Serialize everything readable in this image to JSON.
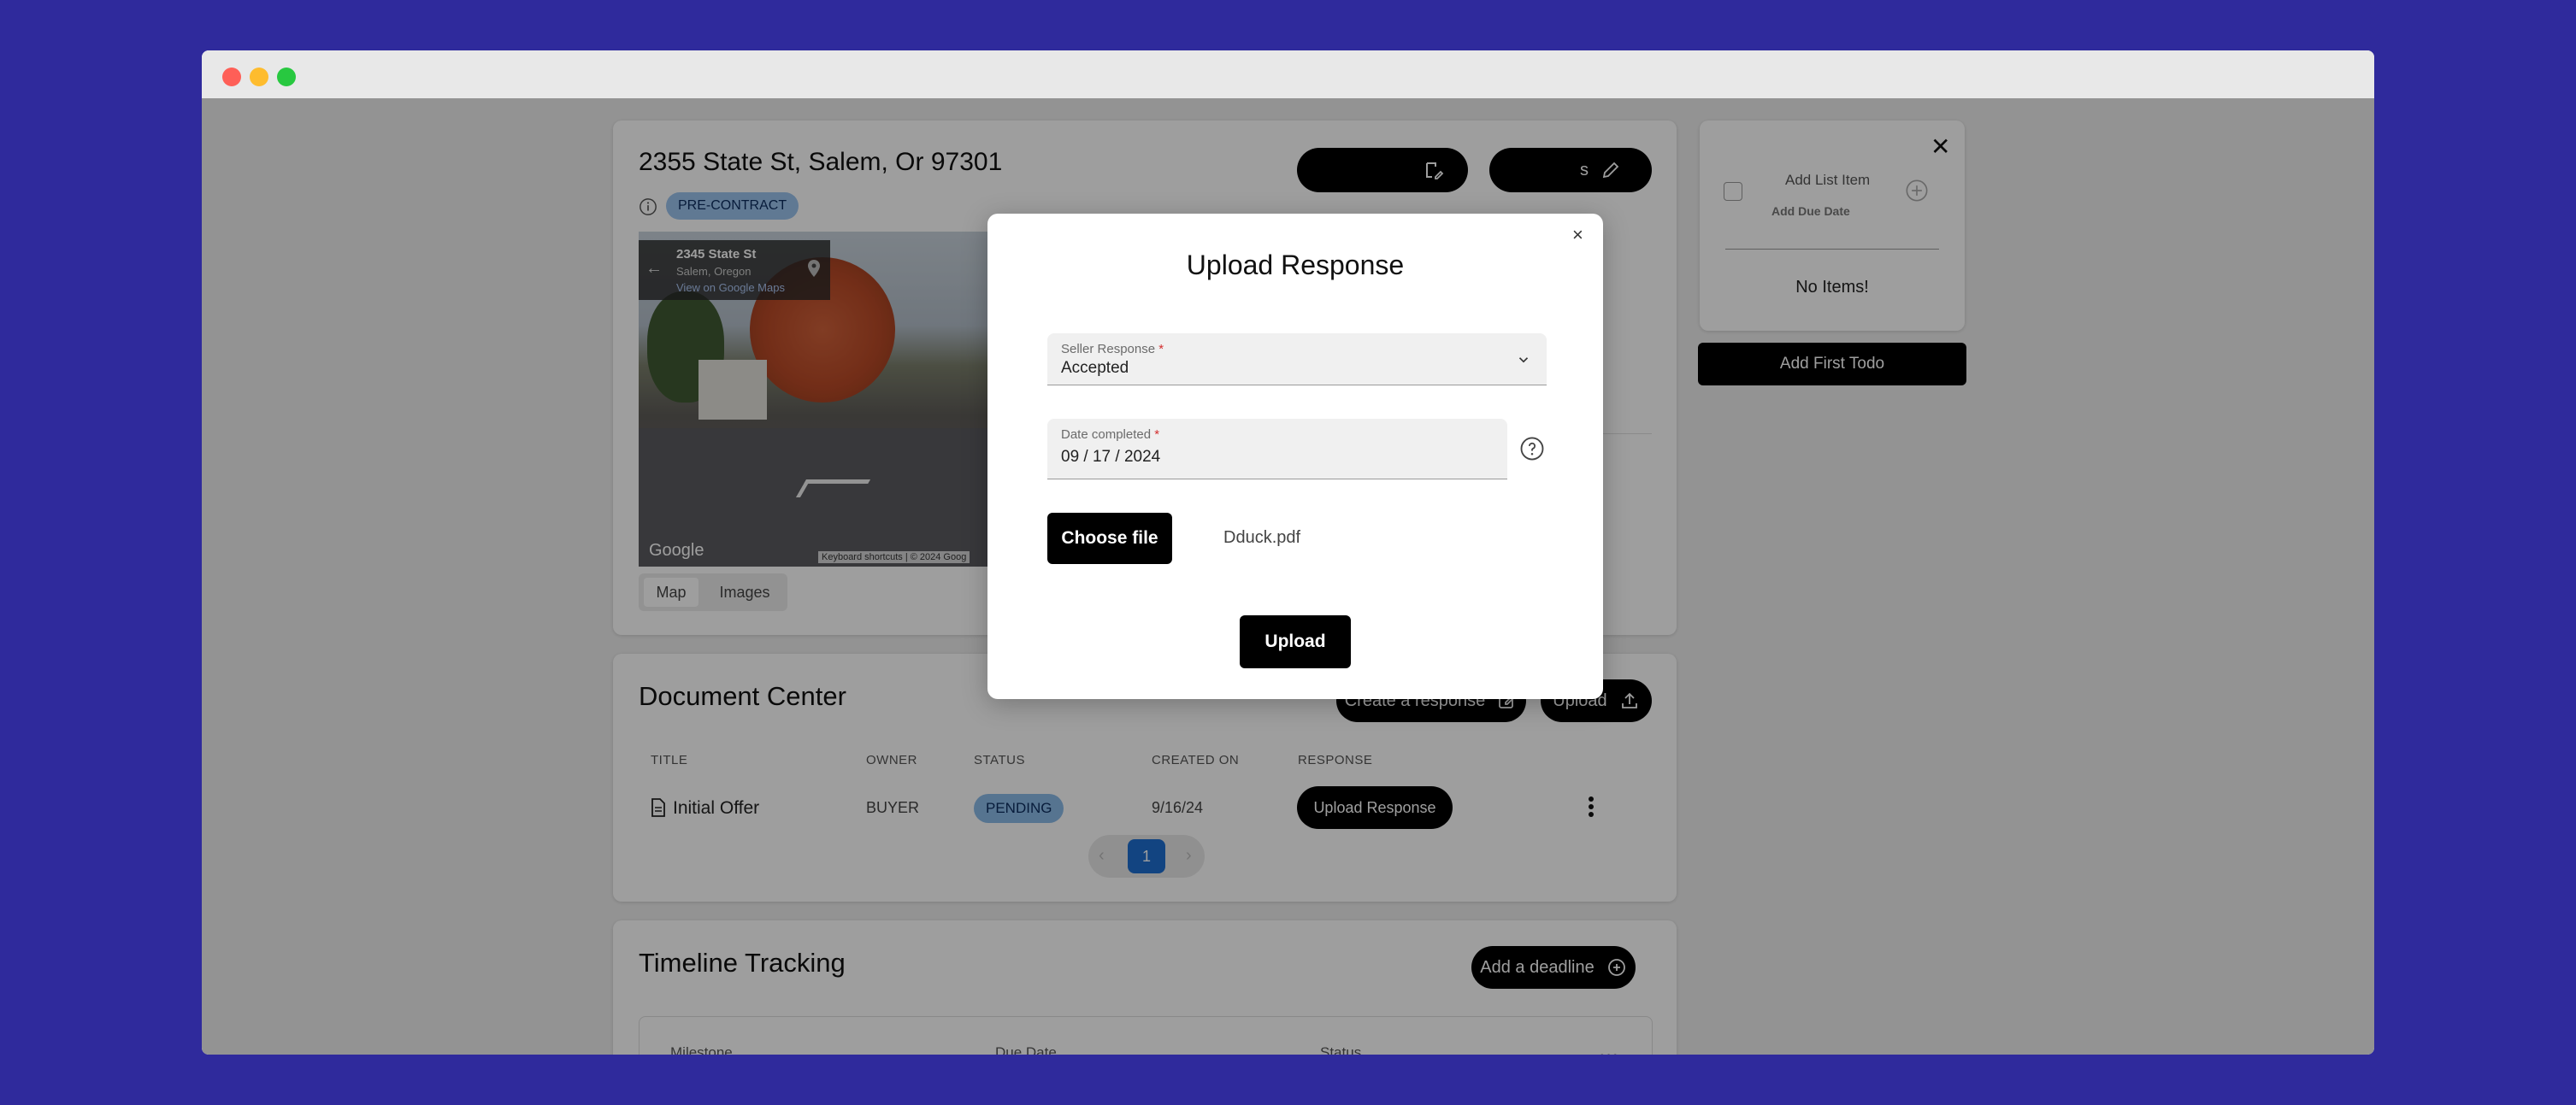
{
  "property": {
    "address": "2355 State St, Salem, Or 97301",
    "stage_badge": "PRE-CONTRACT",
    "map_overlay": {
      "street": "2345 State St",
      "city": "Salem, Oregon",
      "link": "View on Google Maps"
    },
    "map_brand": "Google",
    "map_footer": "Keyboard shortcuts | © 2024 Goog",
    "tabs": [
      "Map",
      "Images"
    ],
    "action_button_2_partial": "s"
  },
  "document_center": {
    "title": "Document Center",
    "create_button": "Create a response",
    "upload_button": "Upload",
    "columns": [
      "TITLE",
      "OWNER",
      "STATUS",
      "CREATED ON",
      "RESPONSE"
    ],
    "rows": [
      {
        "title": "Initial Offer",
        "owner": "BUYER",
        "status": "PENDING",
        "created_on": "9/16/24",
        "response_button": "Upload Response"
      }
    ],
    "pagination": {
      "current_page": "1"
    }
  },
  "timeline": {
    "title": "Timeline Tracking",
    "add_button": "Add a deadline",
    "columns": [
      "Milestone",
      "Due Date",
      "Status"
    ]
  },
  "todo": {
    "add_item_placeholder": "Add List Item",
    "add_due_date": "Add Due Date",
    "empty_text": "No Items!",
    "add_first_button": "Add First Todo"
  },
  "modal": {
    "title": "Upload Response",
    "seller_response_label": "Seller Response",
    "seller_response_value": "Accepted",
    "date_label": "Date completed",
    "date_value": "09 / 17 / 2024",
    "choose_file_button": "Choose file",
    "file_name": "Dduck.pdf",
    "upload_button": "Upload",
    "required_mark": "*"
  },
  "colors": {
    "background": "#2f2a9c",
    "badge_blue": "#9cc3ee",
    "page_active": "#1d6fd1"
  }
}
